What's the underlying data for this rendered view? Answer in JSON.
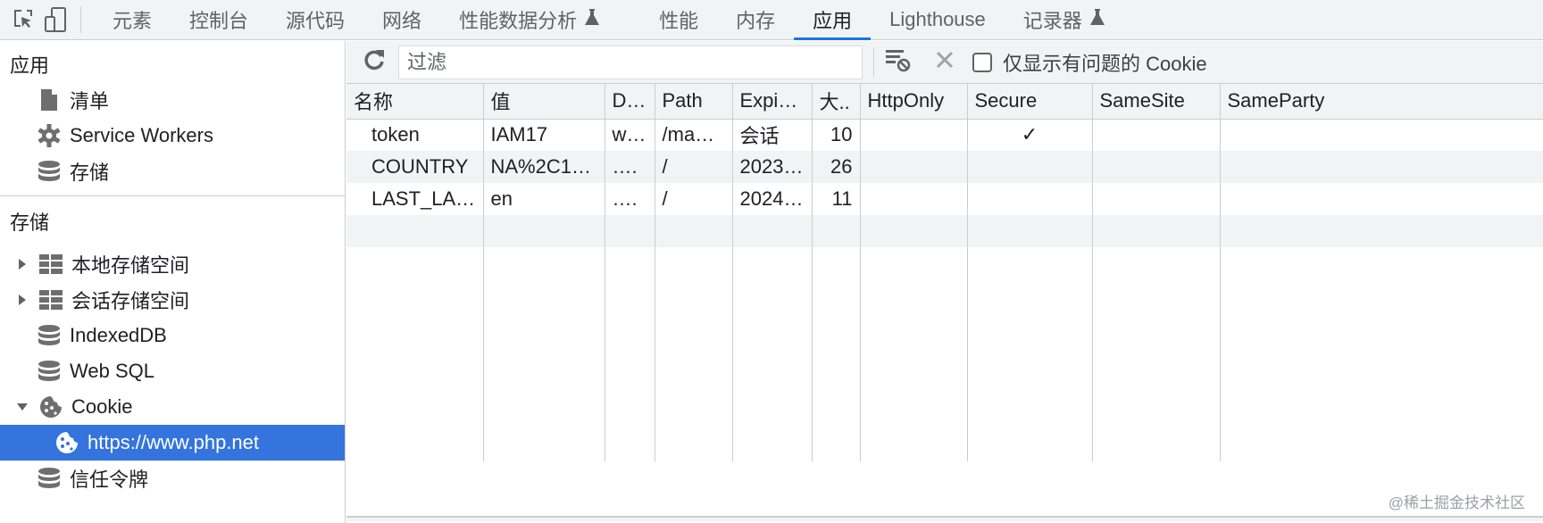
{
  "topbar": {
    "icons": [
      "inspect-element-icon",
      "device-toolbar-icon"
    ],
    "tabs": [
      {
        "label": "元素",
        "active": false,
        "experimental": false
      },
      {
        "label": "控制台",
        "active": false,
        "experimental": false
      },
      {
        "label": "源代码",
        "active": false,
        "experimental": false
      },
      {
        "label": "网络",
        "active": false,
        "experimental": false
      },
      {
        "label": "性能数据分析",
        "active": false,
        "experimental": true
      },
      {
        "label": "性能",
        "active": false,
        "experimental": false
      },
      {
        "label": "内存",
        "active": false,
        "experimental": false
      },
      {
        "label": "应用",
        "active": true,
        "experimental": false
      },
      {
        "label": "Lighthouse",
        "active": false,
        "experimental": false
      },
      {
        "label": "记录器",
        "active": false,
        "experimental": true
      }
    ]
  },
  "sidebar": {
    "app_section": {
      "title": "应用",
      "items": [
        {
          "label": "清单",
          "icon": "document-icon"
        },
        {
          "label": "Service Workers",
          "icon": "gear-icon"
        },
        {
          "label": "存储",
          "icon": "database-icon"
        }
      ]
    },
    "storage_section": {
      "title": "存储",
      "items": [
        {
          "label": "本地存储空间",
          "icon": "table-icon",
          "expander": "collapsed"
        },
        {
          "label": "会话存储空间",
          "icon": "table-icon",
          "expander": "collapsed"
        },
        {
          "label": "IndexedDB",
          "icon": "database-icon"
        },
        {
          "label": "Web SQL",
          "icon": "database-icon"
        },
        {
          "label": "Cookie",
          "icon": "cookie-icon",
          "expander": "expanded"
        },
        {
          "label": "https://www.php.net",
          "icon": "cookie-icon",
          "selected": true
        },
        {
          "label": "信任令牌",
          "icon": "database-icon"
        }
      ]
    }
  },
  "toolbar": {
    "refresh_icon": "refresh-icon",
    "filter_placeholder": "过滤",
    "filter_value": "",
    "clear_filtered_icon": "clear-filtered-icon",
    "delete_icon": "close-icon",
    "only_issues_label": "仅显示有问题的 Cookie",
    "only_issues_checked": false
  },
  "table": {
    "columns": [
      "名称",
      "值",
      "D…",
      "Path",
      "Expir…",
      "大..",
      "HttpOnly",
      "Secure",
      "SameSite",
      "SameParty"
    ],
    "rows": [
      {
        "name": "token",
        "value": "IAM17",
        "domain": "w…",
        "path": "/ma…",
        "expires": "会话",
        "size": "10",
        "httponly": "",
        "secure": "✓",
        "samesite": "",
        "sameparty": ""
      },
      {
        "name": "COUNTRY",
        "value": "NA%2C1…",
        "domain": "….",
        "path": "/",
        "expires": "2023…",
        "size": "26",
        "httponly": "",
        "secure": "",
        "samesite": "",
        "sameparty": ""
      },
      {
        "name": "LAST_LA…",
        "value": "en",
        "domain": "….",
        "path": "/",
        "expires": "2024…",
        "size": "11",
        "httponly": "",
        "secure": "",
        "samesite": "",
        "sameparty": ""
      }
    ]
  },
  "watermark": "@稀土掘金技术社区",
  "colors": {
    "accent": "#1a73e8",
    "selected_bg": "#3474dc",
    "panel_bg": "#f1f3f4",
    "border": "#cbcdd1"
  }
}
